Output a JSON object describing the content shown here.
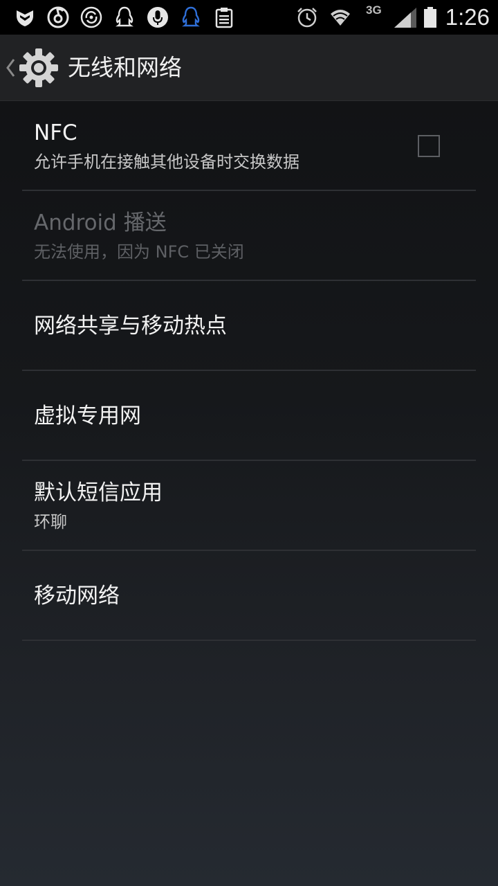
{
  "status_bar": {
    "time": "1:26",
    "network_type": "3G",
    "icons": [
      "shield-icon",
      "netease-music-icon",
      "sync-icon",
      "qq-penguin-icon",
      "microphone-icon",
      "qq-penguin-blue-icon",
      "clipboard-icon",
      "alarm-icon",
      "wifi-icon",
      "signal-icon",
      "battery-icon"
    ],
    "accent_blue": "#2f6fd8"
  },
  "action_bar": {
    "title": "无线和网络",
    "icon": "settings-gear-icon"
  },
  "settings_list": {
    "items": [
      {
        "title": "NFC",
        "summary": "允许手机在接触其他设备时交换数据",
        "checked": false,
        "enabled": true
      },
      {
        "title": "Android 播送",
        "summary": "无法使用，因为 NFC 已关闭",
        "enabled": false
      },
      {
        "title": "网络共享与移动热点"
      },
      {
        "title": "虚拟专用网"
      },
      {
        "title": "默认短信应用",
        "summary": "环聊"
      },
      {
        "title": "移动网络"
      }
    ]
  }
}
